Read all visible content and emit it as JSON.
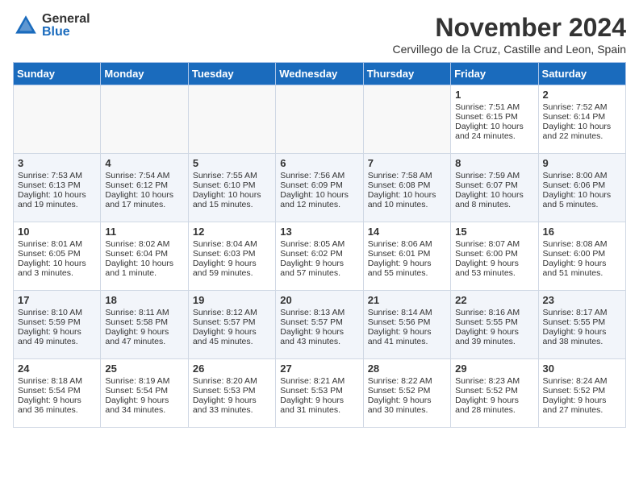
{
  "logo": {
    "general": "General",
    "blue": "Blue"
  },
  "header": {
    "month": "November 2024",
    "location": "Cervillego de la Cruz, Castille and Leon, Spain"
  },
  "weekdays": [
    "Sunday",
    "Monday",
    "Tuesday",
    "Wednesday",
    "Thursday",
    "Friday",
    "Saturday"
  ],
  "weeks": [
    [
      {
        "day": "",
        "content": ""
      },
      {
        "day": "",
        "content": ""
      },
      {
        "day": "",
        "content": ""
      },
      {
        "day": "",
        "content": ""
      },
      {
        "day": "",
        "content": ""
      },
      {
        "day": "1",
        "content": "Sunrise: 7:51 AM\nSunset: 6:15 PM\nDaylight: 10 hours and 24 minutes."
      },
      {
        "day": "2",
        "content": "Sunrise: 7:52 AM\nSunset: 6:14 PM\nDaylight: 10 hours and 22 minutes."
      }
    ],
    [
      {
        "day": "3",
        "content": "Sunrise: 7:53 AM\nSunset: 6:13 PM\nDaylight: 10 hours and 19 minutes."
      },
      {
        "day": "4",
        "content": "Sunrise: 7:54 AM\nSunset: 6:12 PM\nDaylight: 10 hours and 17 minutes."
      },
      {
        "day": "5",
        "content": "Sunrise: 7:55 AM\nSunset: 6:10 PM\nDaylight: 10 hours and 15 minutes."
      },
      {
        "day": "6",
        "content": "Sunrise: 7:56 AM\nSunset: 6:09 PM\nDaylight: 10 hours and 12 minutes."
      },
      {
        "day": "7",
        "content": "Sunrise: 7:58 AM\nSunset: 6:08 PM\nDaylight: 10 hours and 10 minutes."
      },
      {
        "day": "8",
        "content": "Sunrise: 7:59 AM\nSunset: 6:07 PM\nDaylight: 10 hours and 8 minutes."
      },
      {
        "day": "9",
        "content": "Sunrise: 8:00 AM\nSunset: 6:06 PM\nDaylight: 10 hours and 5 minutes."
      }
    ],
    [
      {
        "day": "10",
        "content": "Sunrise: 8:01 AM\nSunset: 6:05 PM\nDaylight: 10 hours and 3 minutes."
      },
      {
        "day": "11",
        "content": "Sunrise: 8:02 AM\nSunset: 6:04 PM\nDaylight: 10 hours and 1 minute."
      },
      {
        "day": "12",
        "content": "Sunrise: 8:04 AM\nSunset: 6:03 PM\nDaylight: 9 hours and 59 minutes."
      },
      {
        "day": "13",
        "content": "Sunrise: 8:05 AM\nSunset: 6:02 PM\nDaylight: 9 hours and 57 minutes."
      },
      {
        "day": "14",
        "content": "Sunrise: 8:06 AM\nSunset: 6:01 PM\nDaylight: 9 hours and 55 minutes."
      },
      {
        "day": "15",
        "content": "Sunrise: 8:07 AM\nSunset: 6:00 PM\nDaylight: 9 hours and 53 minutes."
      },
      {
        "day": "16",
        "content": "Sunrise: 8:08 AM\nSunset: 6:00 PM\nDaylight: 9 hours and 51 minutes."
      }
    ],
    [
      {
        "day": "17",
        "content": "Sunrise: 8:10 AM\nSunset: 5:59 PM\nDaylight: 9 hours and 49 minutes."
      },
      {
        "day": "18",
        "content": "Sunrise: 8:11 AM\nSunset: 5:58 PM\nDaylight: 9 hours and 47 minutes."
      },
      {
        "day": "19",
        "content": "Sunrise: 8:12 AM\nSunset: 5:57 PM\nDaylight: 9 hours and 45 minutes."
      },
      {
        "day": "20",
        "content": "Sunrise: 8:13 AM\nSunset: 5:57 PM\nDaylight: 9 hours and 43 minutes."
      },
      {
        "day": "21",
        "content": "Sunrise: 8:14 AM\nSunset: 5:56 PM\nDaylight: 9 hours and 41 minutes."
      },
      {
        "day": "22",
        "content": "Sunrise: 8:16 AM\nSunset: 5:55 PM\nDaylight: 9 hours and 39 minutes."
      },
      {
        "day": "23",
        "content": "Sunrise: 8:17 AM\nSunset: 5:55 PM\nDaylight: 9 hours and 38 minutes."
      }
    ],
    [
      {
        "day": "24",
        "content": "Sunrise: 8:18 AM\nSunset: 5:54 PM\nDaylight: 9 hours and 36 minutes."
      },
      {
        "day": "25",
        "content": "Sunrise: 8:19 AM\nSunset: 5:54 PM\nDaylight: 9 hours and 34 minutes."
      },
      {
        "day": "26",
        "content": "Sunrise: 8:20 AM\nSunset: 5:53 PM\nDaylight: 9 hours and 33 minutes."
      },
      {
        "day": "27",
        "content": "Sunrise: 8:21 AM\nSunset: 5:53 PM\nDaylight: 9 hours and 31 minutes."
      },
      {
        "day": "28",
        "content": "Sunrise: 8:22 AM\nSunset: 5:52 PM\nDaylight: 9 hours and 30 minutes."
      },
      {
        "day": "29",
        "content": "Sunrise: 8:23 AM\nSunset: 5:52 PM\nDaylight: 9 hours and 28 minutes."
      },
      {
        "day": "30",
        "content": "Sunrise: 8:24 AM\nSunset: 5:52 PM\nDaylight: 9 hours and 27 minutes."
      }
    ]
  ]
}
